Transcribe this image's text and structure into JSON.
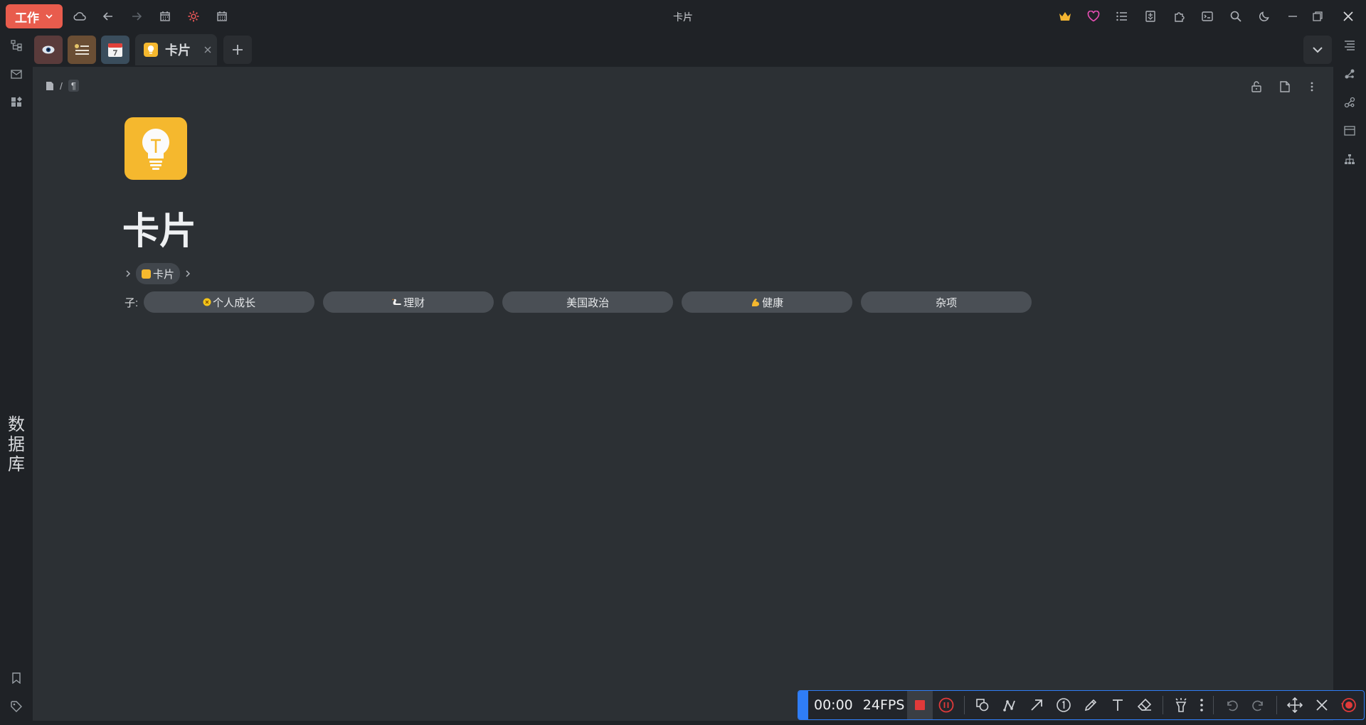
{
  "window": {
    "title": "卡片"
  },
  "workspace": {
    "label": "工作"
  },
  "tabs": {
    "active_title": "卡片"
  },
  "doc": {
    "title": "卡片",
    "path_current": "卡片",
    "children_label": "子:",
    "children": [
      "个人成长",
      "理财",
      "美国政治",
      "健康",
      "杂项"
    ]
  },
  "dock": {
    "database_label": "数据库"
  },
  "recorder": {
    "time": "00:00",
    "fps": "24FPS"
  },
  "colors": {
    "accent": "#e85c4d",
    "bulb": "#f5b82e",
    "record_blue": "#2f7df6",
    "record_red": "#e03a3a"
  }
}
